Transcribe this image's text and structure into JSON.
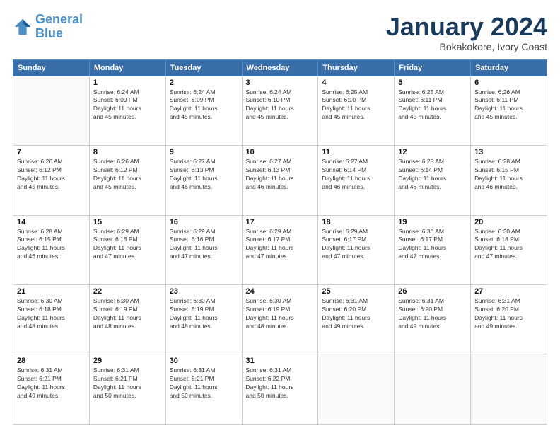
{
  "header": {
    "logo_line1": "General",
    "logo_line2": "Blue",
    "month": "January 2024",
    "location": "Bokakokore, Ivory Coast"
  },
  "weekdays": [
    "Sunday",
    "Monday",
    "Tuesday",
    "Wednesday",
    "Thursday",
    "Friday",
    "Saturday"
  ],
  "weeks": [
    [
      {
        "day": "",
        "info": ""
      },
      {
        "day": "1",
        "info": "Sunrise: 6:24 AM\nSunset: 6:09 PM\nDaylight: 11 hours\nand 45 minutes."
      },
      {
        "day": "2",
        "info": "Sunrise: 6:24 AM\nSunset: 6:09 PM\nDaylight: 11 hours\nand 45 minutes."
      },
      {
        "day": "3",
        "info": "Sunrise: 6:24 AM\nSunset: 6:10 PM\nDaylight: 11 hours\nand 45 minutes."
      },
      {
        "day": "4",
        "info": "Sunrise: 6:25 AM\nSunset: 6:10 PM\nDaylight: 11 hours\nand 45 minutes."
      },
      {
        "day": "5",
        "info": "Sunrise: 6:25 AM\nSunset: 6:11 PM\nDaylight: 11 hours\nand 45 minutes."
      },
      {
        "day": "6",
        "info": "Sunrise: 6:26 AM\nSunset: 6:11 PM\nDaylight: 11 hours\nand 45 minutes."
      }
    ],
    [
      {
        "day": "7",
        "info": "Sunrise: 6:26 AM\nSunset: 6:12 PM\nDaylight: 11 hours\nand 45 minutes."
      },
      {
        "day": "8",
        "info": "Sunrise: 6:26 AM\nSunset: 6:12 PM\nDaylight: 11 hours\nand 45 minutes."
      },
      {
        "day": "9",
        "info": "Sunrise: 6:27 AM\nSunset: 6:13 PM\nDaylight: 11 hours\nand 46 minutes."
      },
      {
        "day": "10",
        "info": "Sunrise: 6:27 AM\nSunset: 6:13 PM\nDaylight: 11 hours\nand 46 minutes."
      },
      {
        "day": "11",
        "info": "Sunrise: 6:27 AM\nSunset: 6:14 PM\nDaylight: 11 hours\nand 46 minutes."
      },
      {
        "day": "12",
        "info": "Sunrise: 6:28 AM\nSunset: 6:14 PM\nDaylight: 11 hours\nand 46 minutes."
      },
      {
        "day": "13",
        "info": "Sunrise: 6:28 AM\nSunset: 6:15 PM\nDaylight: 11 hours\nand 46 minutes."
      }
    ],
    [
      {
        "day": "14",
        "info": "Sunrise: 6:28 AM\nSunset: 6:15 PM\nDaylight: 11 hours\nand 46 minutes."
      },
      {
        "day": "15",
        "info": "Sunrise: 6:29 AM\nSunset: 6:16 PM\nDaylight: 11 hours\nand 47 minutes."
      },
      {
        "day": "16",
        "info": "Sunrise: 6:29 AM\nSunset: 6:16 PM\nDaylight: 11 hours\nand 47 minutes."
      },
      {
        "day": "17",
        "info": "Sunrise: 6:29 AM\nSunset: 6:17 PM\nDaylight: 11 hours\nand 47 minutes."
      },
      {
        "day": "18",
        "info": "Sunrise: 6:29 AM\nSunset: 6:17 PM\nDaylight: 11 hours\nand 47 minutes."
      },
      {
        "day": "19",
        "info": "Sunrise: 6:30 AM\nSunset: 6:17 PM\nDaylight: 11 hours\nand 47 minutes."
      },
      {
        "day": "20",
        "info": "Sunrise: 6:30 AM\nSunset: 6:18 PM\nDaylight: 11 hours\nand 47 minutes."
      }
    ],
    [
      {
        "day": "21",
        "info": "Sunrise: 6:30 AM\nSunset: 6:18 PM\nDaylight: 11 hours\nand 48 minutes."
      },
      {
        "day": "22",
        "info": "Sunrise: 6:30 AM\nSunset: 6:19 PM\nDaylight: 11 hours\nand 48 minutes."
      },
      {
        "day": "23",
        "info": "Sunrise: 6:30 AM\nSunset: 6:19 PM\nDaylight: 11 hours\nand 48 minutes."
      },
      {
        "day": "24",
        "info": "Sunrise: 6:30 AM\nSunset: 6:19 PM\nDaylight: 11 hours\nand 48 minutes."
      },
      {
        "day": "25",
        "info": "Sunrise: 6:31 AM\nSunset: 6:20 PM\nDaylight: 11 hours\nand 49 minutes."
      },
      {
        "day": "26",
        "info": "Sunrise: 6:31 AM\nSunset: 6:20 PM\nDaylight: 11 hours\nand 49 minutes."
      },
      {
        "day": "27",
        "info": "Sunrise: 6:31 AM\nSunset: 6:20 PM\nDaylight: 11 hours\nand 49 minutes."
      }
    ],
    [
      {
        "day": "28",
        "info": "Sunrise: 6:31 AM\nSunset: 6:21 PM\nDaylight: 11 hours\nand 49 minutes."
      },
      {
        "day": "29",
        "info": "Sunrise: 6:31 AM\nSunset: 6:21 PM\nDaylight: 11 hours\nand 50 minutes."
      },
      {
        "day": "30",
        "info": "Sunrise: 6:31 AM\nSunset: 6:21 PM\nDaylight: 11 hours\nand 50 minutes."
      },
      {
        "day": "31",
        "info": "Sunrise: 6:31 AM\nSunset: 6:22 PM\nDaylight: 11 hours\nand 50 minutes."
      },
      {
        "day": "",
        "info": ""
      },
      {
        "day": "",
        "info": ""
      },
      {
        "day": "",
        "info": ""
      }
    ]
  ]
}
